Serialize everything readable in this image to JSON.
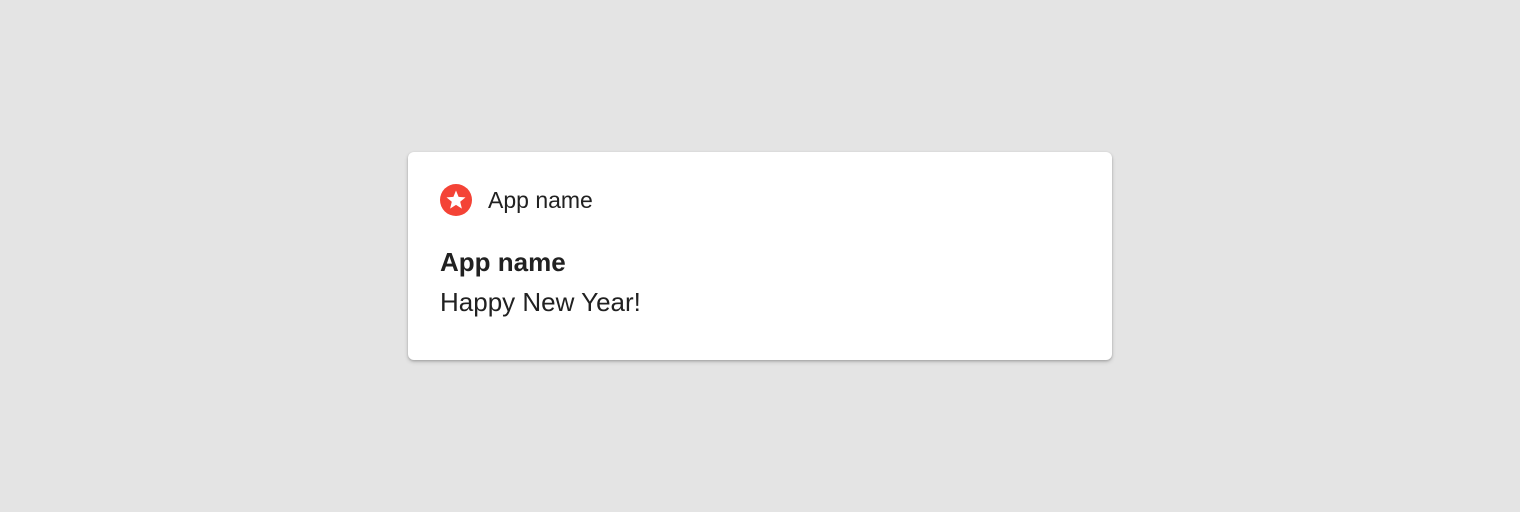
{
  "notification": {
    "header_app_name": "App name",
    "title": "App name",
    "body": "Happy New Year!",
    "icon": "star-icon",
    "accent_color": "#f44336"
  },
  "background_color": "#e4e4e4"
}
